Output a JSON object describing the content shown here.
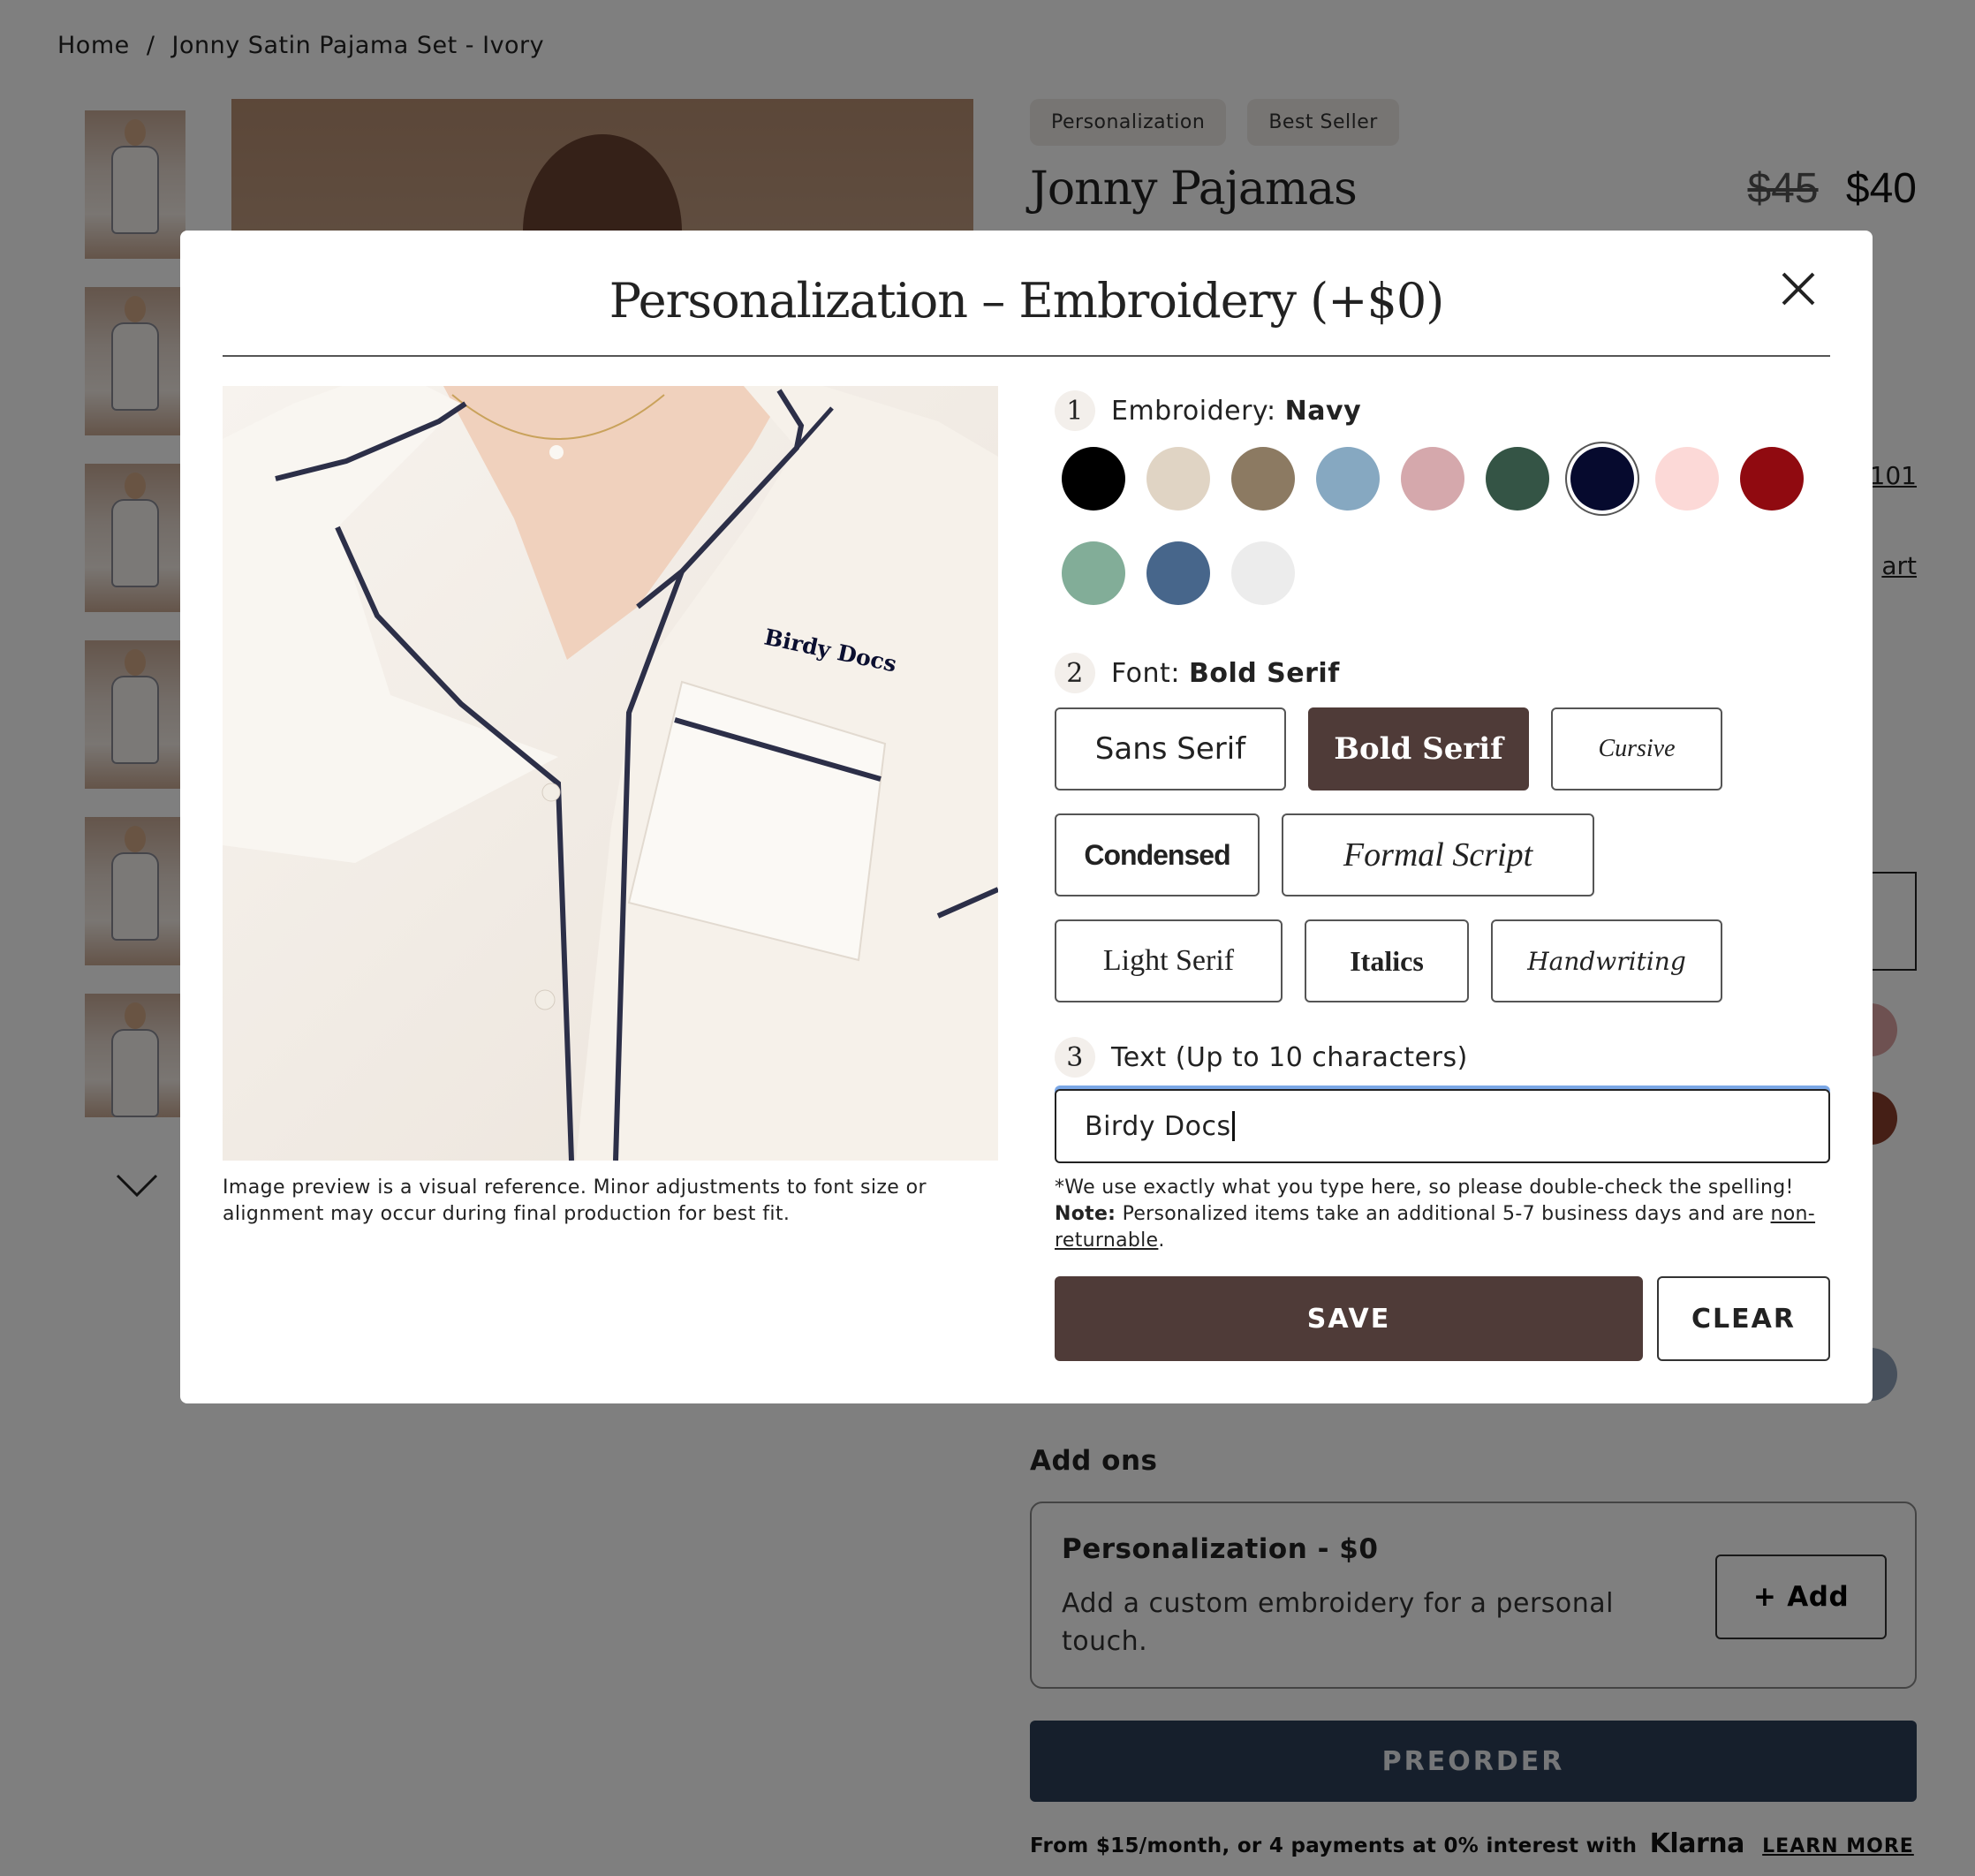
{
  "breadcrumb": {
    "home": "Home",
    "separator": "/",
    "current": "Jonny Satin Pajama Set - Ivory"
  },
  "product": {
    "tags": [
      "Personalization",
      "Best Seller"
    ],
    "title": "Jonny Pajamas",
    "price_old": "$45",
    "price_new": "$40",
    "side_links": [
      "101",
      "art"
    ]
  },
  "addons": {
    "title": "Add ons",
    "item_name": "Personalization - $0",
    "item_desc": "Add a custom embroidery for a personal touch.",
    "add_label": "Add",
    "add_symbol": "+"
  },
  "preorder_label": "PREORDER",
  "klarna": {
    "text": "From $15/month, or 4 payments at 0% interest with",
    "brand": "Klarna",
    "learn_more": "LEARN MORE"
  },
  "modal": {
    "title": "Personalization – Embroidery (+$0)",
    "preview_text": "Birdy Docs",
    "preview_caption": "Image preview is a visual reference. Minor adjustments to font size or alignment may occur during final production for best fit.",
    "step1": {
      "num": "1",
      "label": "Embroidery:",
      "value": "Navy"
    },
    "colors": [
      {
        "name": "Black",
        "hex": "#000000"
      },
      {
        "name": "Beige",
        "hex": "#e0d4c4"
      },
      {
        "name": "Taupe",
        "hex": "#8c7a62"
      },
      {
        "name": "Light Blue",
        "hex": "#86a8c1"
      },
      {
        "name": "Dusty Pink",
        "hex": "#d5a8ac"
      },
      {
        "name": "Forest",
        "hex": "#345445"
      },
      {
        "name": "Navy",
        "hex": "#060a2e"
      },
      {
        "name": "Blush",
        "hex": "#fcd9d7"
      },
      {
        "name": "Red",
        "hex": "#900a10"
      },
      {
        "name": "Sage",
        "hex": "#82ad98"
      },
      {
        "name": "Slate Blue",
        "hex": "#47668b"
      },
      {
        "name": "White",
        "hex": "#ececec"
      }
    ],
    "selected_color": "Navy",
    "step2": {
      "num": "2",
      "label": "Font:",
      "value": "Bold Serif"
    },
    "fonts": [
      "Sans Serif",
      "Bold Serif",
      "Cursive",
      "Condensed",
      "Formal Script",
      "Light Serif",
      "Italics",
      "Handwriting"
    ],
    "selected_font": "Bold Serif",
    "step3": {
      "num": "3",
      "label": "Text (Up to 10 characters)"
    },
    "text_value": "Birdy Docs",
    "note1": "*We use exactly what you type here, so please double-check the spelling!",
    "note2_label": "Note:",
    "note2_text": "Personalized items take an additional 5-7 business days and are",
    "note2_link": "non-returnable",
    "note2_end": ".",
    "save_label": "SAVE",
    "clear_label": "CLEAR"
  }
}
